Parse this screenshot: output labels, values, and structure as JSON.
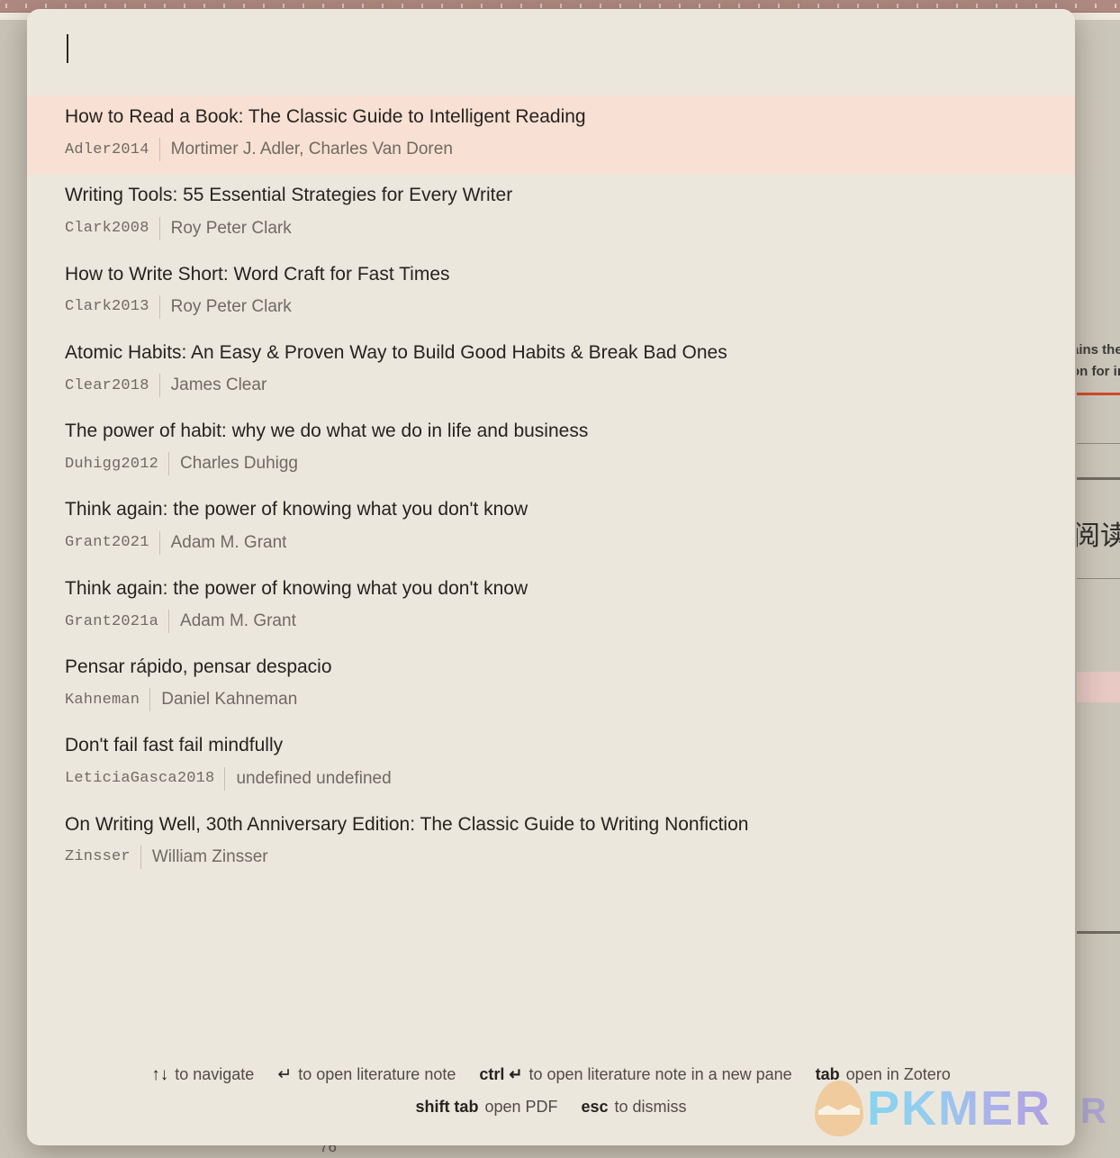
{
  "background": {
    "page_number": "76",
    "fragments": [
      {
        "text": "ains the"
      },
      {
        "text": "on for in"
      }
    ],
    "cjk_text": "阅读",
    "logo_letter": "R"
  },
  "modal": {
    "search": {
      "value": "",
      "placeholder": ""
    },
    "results": [
      {
        "title": "How to Read a Book: The Classic Guide to Intelligent Reading",
        "citekey": "Adler2014",
        "authors": "Mortimer J. Adler, Charles Van Doren",
        "selected": true
      },
      {
        "title": "Writing Tools: 55 Essential Strategies for Every Writer",
        "citekey": "Clark2008",
        "authors": "Roy Peter Clark",
        "selected": false
      },
      {
        "title": "How to Write Short: Word Craft for Fast Times",
        "citekey": "Clark2013",
        "authors": "Roy Peter Clark",
        "selected": false
      },
      {
        "title": "Atomic Habits: An Easy & Proven Way to Build Good Habits & Break Bad Ones",
        "citekey": "Clear2018",
        "authors": "James Clear",
        "selected": false
      },
      {
        "title": "The power of habit: why we do what we do in life and business",
        "citekey": "Duhigg2012",
        "authors": "Charles Duhigg",
        "selected": false
      },
      {
        "title": "Think again: the power of knowing what you don't know",
        "citekey": "Grant2021",
        "authors": "Adam M. Grant",
        "selected": false
      },
      {
        "title": "Think again: the power of knowing what you don't know",
        "citekey": "Grant2021a",
        "authors": "Adam M. Grant",
        "selected": false
      },
      {
        "title": "Pensar rápido, pensar despacio",
        "citekey": "Kahneman",
        "authors": "Daniel Kahneman",
        "selected": false
      },
      {
        "title": "Don't fail fast fail mindfully",
        "citekey": "LeticiaGasca2018",
        "authors": "undefined undefined",
        "selected": false
      },
      {
        "title": "On Writing Well, 30th Anniversary Edition: The Classic Guide to Writing Nonfiction",
        "citekey": "Zinsser",
        "authors": "William Zinsser",
        "selected": false
      }
    ],
    "hints_row1": [
      {
        "key": "↑↓",
        "desc": "to navigate",
        "symbol": true
      },
      {
        "key": "↵",
        "desc": "to open literature note",
        "symbol": true
      },
      {
        "key": "ctrl ↵",
        "desc": "to open literature note in a new pane",
        "symbol": false
      },
      {
        "key": "tab",
        "desc": "open in Zotero",
        "symbol": false
      }
    ],
    "hints_row2": [
      {
        "key": "shift tab",
        "desc": "open PDF",
        "symbol": false
      },
      {
        "key": "esc",
        "desc": "to dismiss",
        "symbol": false
      }
    ],
    "watermark": {
      "text": "PKMER"
    }
  },
  "colors": {
    "modal_bg": "#ece7dd",
    "selected_row": "#f8e0d4",
    "title_text": "#26231f",
    "meta_text": "#6f6a62",
    "backdrop": "#b9b3a6",
    "toolbar": "#b08a80",
    "accent_red": "#d4472a"
  }
}
